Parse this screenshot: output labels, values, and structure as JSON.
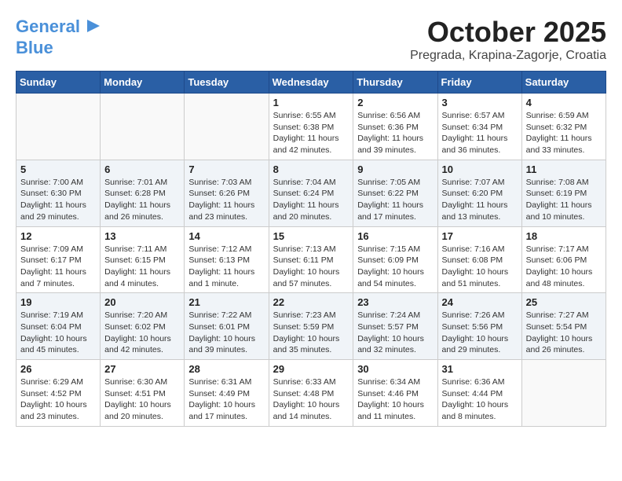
{
  "logo": {
    "line1": "General",
    "line2": "Blue"
  },
  "title": "October 2025",
  "location": "Pregrada, Krapina-Zagorje, Croatia",
  "headers": [
    "Sunday",
    "Monday",
    "Tuesday",
    "Wednesday",
    "Thursday",
    "Friday",
    "Saturday"
  ],
  "weeks": [
    [
      {
        "day": "",
        "info": ""
      },
      {
        "day": "",
        "info": ""
      },
      {
        "day": "",
        "info": ""
      },
      {
        "day": "1",
        "info": "Sunrise: 6:55 AM\nSunset: 6:38 PM\nDaylight: 11 hours and 42 minutes."
      },
      {
        "day": "2",
        "info": "Sunrise: 6:56 AM\nSunset: 6:36 PM\nDaylight: 11 hours and 39 minutes."
      },
      {
        "day": "3",
        "info": "Sunrise: 6:57 AM\nSunset: 6:34 PM\nDaylight: 11 hours and 36 minutes."
      },
      {
        "day": "4",
        "info": "Sunrise: 6:59 AM\nSunset: 6:32 PM\nDaylight: 11 hours and 33 minutes."
      }
    ],
    [
      {
        "day": "5",
        "info": "Sunrise: 7:00 AM\nSunset: 6:30 PM\nDaylight: 11 hours and 29 minutes."
      },
      {
        "day": "6",
        "info": "Sunrise: 7:01 AM\nSunset: 6:28 PM\nDaylight: 11 hours and 26 minutes."
      },
      {
        "day": "7",
        "info": "Sunrise: 7:03 AM\nSunset: 6:26 PM\nDaylight: 11 hours and 23 minutes."
      },
      {
        "day": "8",
        "info": "Sunrise: 7:04 AM\nSunset: 6:24 PM\nDaylight: 11 hours and 20 minutes."
      },
      {
        "day": "9",
        "info": "Sunrise: 7:05 AM\nSunset: 6:22 PM\nDaylight: 11 hours and 17 minutes."
      },
      {
        "day": "10",
        "info": "Sunrise: 7:07 AM\nSunset: 6:20 PM\nDaylight: 11 hours and 13 minutes."
      },
      {
        "day": "11",
        "info": "Sunrise: 7:08 AM\nSunset: 6:19 PM\nDaylight: 11 hours and 10 minutes."
      }
    ],
    [
      {
        "day": "12",
        "info": "Sunrise: 7:09 AM\nSunset: 6:17 PM\nDaylight: 11 hours and 7 minutes."
      },
      {
        "day": "13",
        "info": "Sunrise: 7:11 AM\nSunset: 6:15 PM\nDaylight: 11 hours and 4 minutes."
      },
      {
        "day": "14",
        "info": "Sunrise: 7:12 AM\nSunset: 6:13 PM\nDaylight: 11 hours and 1 minute."
      },
      {
        "day": "15",
        "info": "Sunrise: 7:13 AM\nSunset: 6:11 PM\nDaylight: 10 hours and 57 minutes."
      },
      {
        "day": "16",
        "info": "Sunrise: 7:15 AM\nSunset: 6:09 PM\nDaylight: 10 hours and 54 minutes."
      },
      {
        "day": "17",
        "info": "Sunrise: 7:16 AM\nSunset: 6:08 PM\nDaylight: 10 hours and 51 minutes."
      },
      {
        "day": "18",
        "info": "Sunrise: 7:17 AM\nSunset: 6:06 PM\nDaylight: 10 hours and 48 minutes."
      }
    ],
    [
      {
        "day": "19",
        "info": "Sunrise: 7:19 AM\nSunset: 6:04 PM\nDaylight: 10 hours and 45 minutes."
      },
      {
        "day": "20",
        "info": "Sunrise: 7:20 AM\nSunset: 6:02 PM\nDaylight: 10 hours and 42 minutes."
      },
      {
        "day": "21",
        "info": "Sunrise: 7:22 AM\nSunset: 6:01 PM\nDaylight: 10 hours and 39 minutes."
      },
      {
        "day": "22",
        "info": "Sunrise: 7:23 AM\nSunset: 5:59 PM\nDaylight: 10 hours and 35 minutes."
      },
      {
        "day": "23",
        "info": "Sunrise: 7:24 AM\nSunset: 5:57 PM\nDaylight: 10 hours and 32 minutes."
      },
      {
        "day": "24",
        "info": "Sunrise: 7:26 AM\nSunset: 5:56 PM\nDaylight: 10 hours and 29 minutes."
      },
      {
        "day": "25",
        "info": "Sunrise: 7:27 AM\nSunset: 5:54 PM\nDaylight: 10 hours and 26 minutes."
      }
    ],
    [
      {
        "day": "26",
        "info": "Sunrise: 6:29 AM\nSunset: 4:52 PM\nDaylight: 10 hours and 23 minutes."
      },
      {
        "day": "27",
        "info": "Sunrise: 6:30 AM\nSunset: 4:51 PM\nDaylight: 10 hours and 20 minutes."
      },
      {
        "day": "28",
        "info": "Sunrise: 6:31 AM\nSunset: 4:49 PM\nDaylight: 10 hours and 17 minutes."
      },
      {
        "day": "29",
        "info": "Sunrise: 6:33 AM\nSunset: 4:48 PM\nDaylight: 10 hours and 14 minutes."
      },
      {
        "day": "30",
        "info": "Sunrise: 6:34 AM\nSunset: 4:46 PM\nDaylight: 10 hours and 11 minutes."
      },
      {
        "day": "31",
        "info": "Sunrise: 6:36 AM\nSunset: 4:44 PM\nDaylight: 10 hours and 8 minutes."
      },
      {
        "day": "",
        "info": ""
      }
    ]
  ]
}
